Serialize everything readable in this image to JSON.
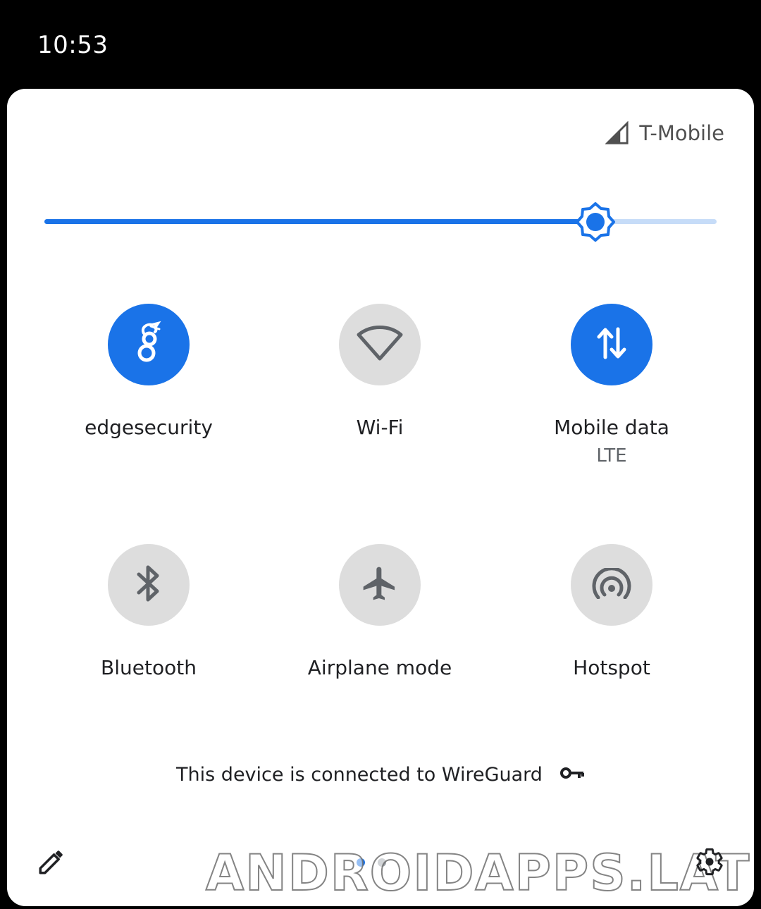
{
  "status_bar": {
    "time": "10:53"
  },
  "header": {
    "carrier": "T-Mobile",
    "signal_icon": "signal-icon"
  },
  "brightness": {
    "level": 0.82,
    "icon": "brightness-icon",
    "colors": {
      "fill": "#1a73e8",
      "track": "#c6dcf8"
    }
  },
  "tiles": [
    {
      "label": "edgesecurity",
      "sublabel": "",
      "icon": "wireguard-icon",
      "active": true
    },
    {
      "label": "Wi-Fi",
      "sublabel": "",
      "icon": "wifi-icon",
      "active": false
    },
    {
      "label": "Mobile data",
      "sublabel": "LTE",
      "icon": "mobile-data-icon",
      "active": true
    },
    {
      "label": "Bluetooth",
      "sublabel": "",
      "icon": "bluetooth-icon",
      "active": false
    },
    {
      "label": "Airplane mode",
      "sublabel": "",
      "icon": "airplane-icon",
      "active": false
    },
    {
      "label": "Hotspot",
      "sublabel": "",
      "icon": "hotspot-icon",
      "active": false
    }
  ],
  "vpn_notice": {
    "text": "This device is connected to WireGuard",
    "icon": "vpn-key-icon"
  },
  "footer": {
    "edit_icon": "pencil-icon",
    "settings_icon": "gear-icon",
    "page_indicator": {
      "current": 1,
      "total": 2
    }
  },
  "watermark": "ANDROIDAPPS.LAT",
  "colors": {
    "accent": "#1a73e8",
    "tile_off": "#dddddd",
    "icon_off": "#5f6368",
    "background": "#ffffff"
  }
}
